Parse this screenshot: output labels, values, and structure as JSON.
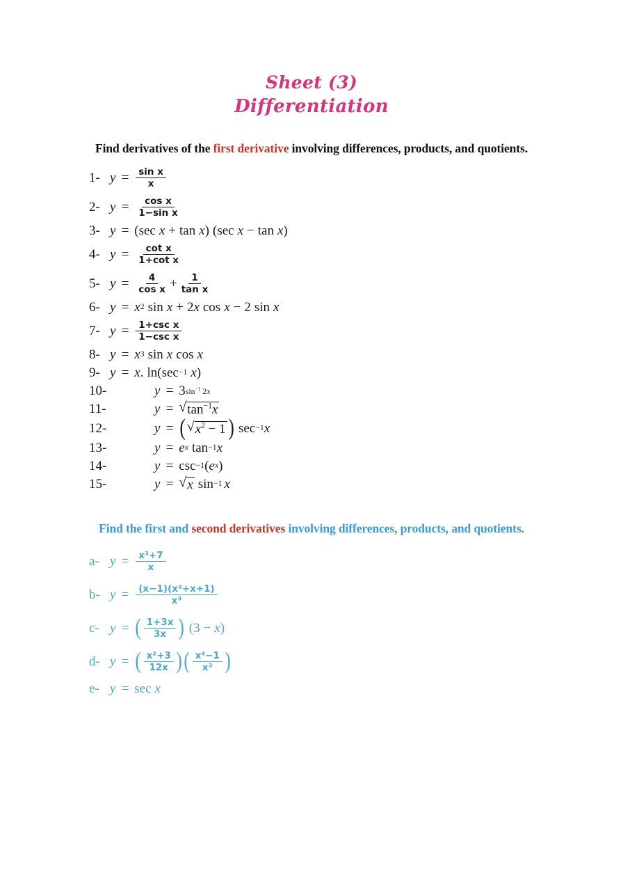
{
  "document": {
    "title_line_1": "Sheet (3)",
    "title_line_2": "Differentiation",
    "title_color": "#d4367e"
  },
  "section_1": {
    "heading_prefix": "Find derivatives of the ",
    "heading_highlight": "first derivative",
    "heading_suffix": " involving differences, products, and quotients.",
    "heading_color": "#111111",
    "highlight_color": "#c0392b",
    "items": [
      {
        "number": "1-",
        "equation": "y = sin x / x"
      },
      {
        "number": "2-",
        "equation": "y = cos x / (1 - sin x)"
      },
      {
        "number": "3-",
        "equation": "y = (sec x + tan x)(sec x - tan x)"
      },
      {
        "number": "4-",
        "equation": "y = cot x / (1 + cot x)"
      },
      {
        "number": "5-",
        "equation": "y = 4/cos x + 1/tan x"
      },
      {
        "number": "6-",
        "equation": "y = x^2 sin x + 2x cos x - 2 sin x"
      },
      {
        "number": "7-",
        "equation": "y = (1 + csc x) / (1 - csc x)"
      },
      {
        "number": "8-",
        "equation": "y = x^3 sin x cos x"
      },
      {
        "number": "9-",
        "equation": "y = x. ln(sec^-1 x)"
      },
      {
        "number": "10-",
        "equation": "y = 3^(sin^-1 2x)"
      },
      {
        "number": "11-",
        "equation": "y = sqrt(tan^-1 x)"
      },
      {
        "number": "12-",
        "equation": "y = (sqrt(x^2 - 1)) sec^-1 x"
      },
      {
        "number": "13-",
        "equation": "y = e^x tan^-1 x"
      },
      {
        "number": "14-",
        "equation": "y = csc^-1(e^x)"
      },
      {
        "number": "15-",
        "equation": "y = sqrt(x) sin^-1 x"
      }
    ]
  },
  "section_2": {
    "heading_prefix": "Find the first and ",
    "heading_highlight": "second derivatives",
    "heading_suffix": " involving differences, products, and quotients.",
    "heading_color": "#3d9ad8",
    "highlight_color": "#c0392b",
    "items": [
      {
        "number": "a-",
        "equation": "y = (x^3 + 7) / x"
      },
      {
        "number": "b-",
        "equation": "y = (x-1)(x^2+x+1) / x^3"
      },
      {
        "number": "c-",
        "equation": "y = ((1+3x)/3x)(3 - x)"
      },
      {
        "number": "d-",
        "equation": "y = ((x^2+3)/12x)((x^4-1)/x^3)"
      },
      {
        "number": "e-",
        "equation": "y = sec x"
      }
    ]
  },
  "tokens": {
    "y": "y",
    "equals": "=",
    "x": "x",
    "sin": "sin",
    "cos": "cos",
    "tan": "tan",
    "sec": "sec",
    "csc": "csc",
    "cot": "cot",
    "ln": "ln",
    "e": "e",
    "plus": "+",
    "minus": "−",
    "one": "1",
    "two": "2",
    "three": "3",
    "four": "4",
    "seven": "7",
    "twelve": "12",
    "sin_x": "sin x",
    "cos_x": "cos x",
    "tan_x": "tan x",
    "cot_x": "cot x",
    "one_minus_sin_x": "1−sin x",
    "one_plus_cot_x": "1+cot x",
    "one_plus_csc_x": "1+csc x",
    "one_minus_csc_x": "1−csc x",
    "x3_plus_7": "x³+7",
    "numer_b": "(x−1)(x²+x+1)",
    "x_cubed": "x³",
    "one_plus_3x": "1+3x",
    "three_x": "3x",
    "x2_plus_3": "x²+3",
    "twelve_x": "12x",
    "x4_minus_1": "x⁴−1"
  }
}
